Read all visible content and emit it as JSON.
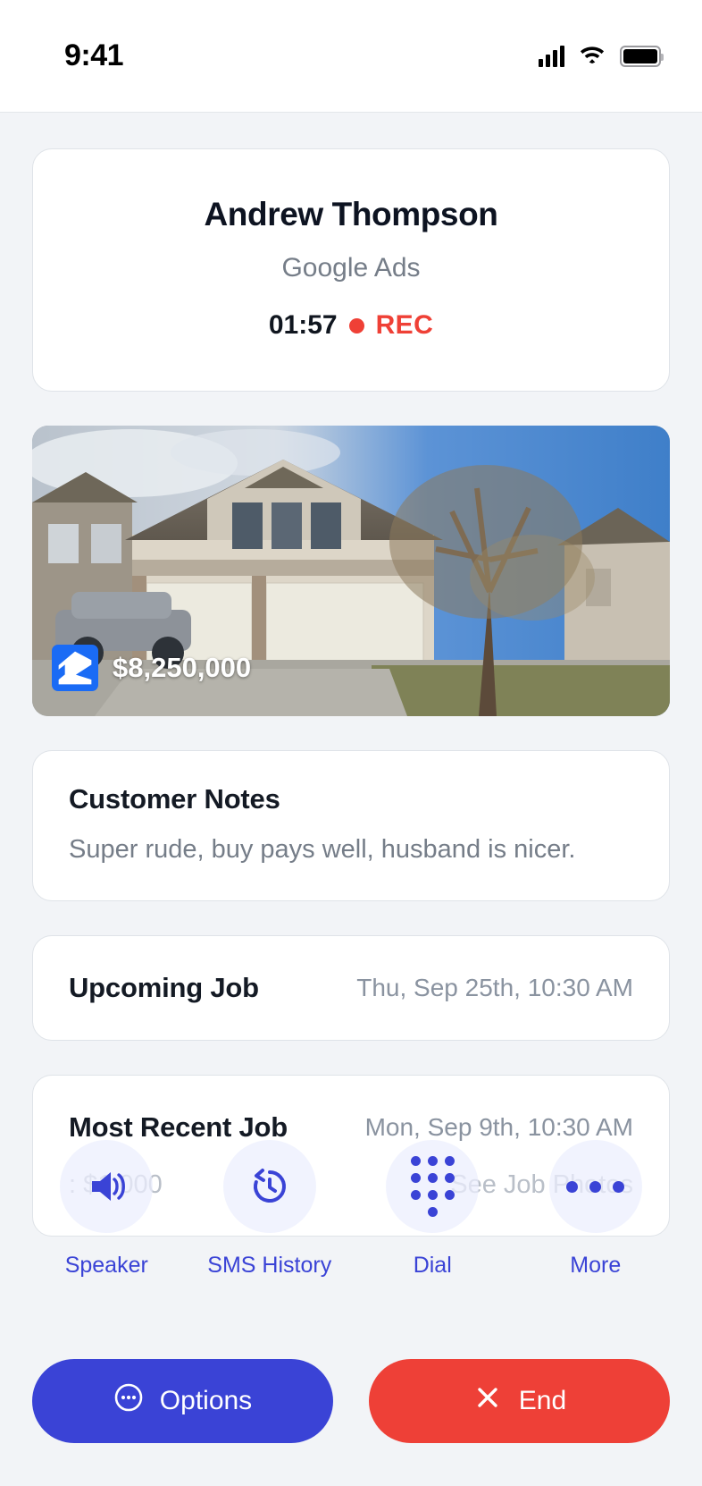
{
  "status_bar": {
    "time": "9:41",
    "signal_icon": "signal-bars-icon",
    "wifi_icon": "wifi-icon",
    "battery_icon": "battery-full-icon"
  },
  "caller": {
    "name": "Andrew Thompson",
    "source": "Google Ads",
    "timer": "01:57",
    "recording_label": "REC",
    "recording_color": "#ef4036"
  },
  "property": {
    "price": "$8,250,000",
    "logo_name": "zillow-logo"
  },
  "notes": {
    "title": "Customer Notes",
    "body": "Super rude, buy pays well, husband is nicer."
  },
  "upcoming_job": {
    "label": "Upcoming Job",
    "date": "Thu, Sep 25th, 10:30 AM"
  },
  "recent_job": {
    "label": "Most Recent Job",
    "date": "Mon, Sep 9th, 10:30 AM",
    "amount": ": $1,000",
    "photos_link": "See Job Photos"
  },
  "actions": [
    {
      "label": "Speaker",
      "icon": "speaker-icon"
    },
    {
      "label": "SMS History",
      "icon": "clock-history-icon"
    },
    {
      "label": "Dial",
      "icon": "dialpad-icon"
    },
    {
      "label": "More",
      "icon": "ellipsis-icon"
    }
  ],
  "bottom_buttons": {
    "options_label": "Options",
    "options_color": "#3a43d6",
    "end_label": "End",
    "end_color": "#ee4037"
  }
}
